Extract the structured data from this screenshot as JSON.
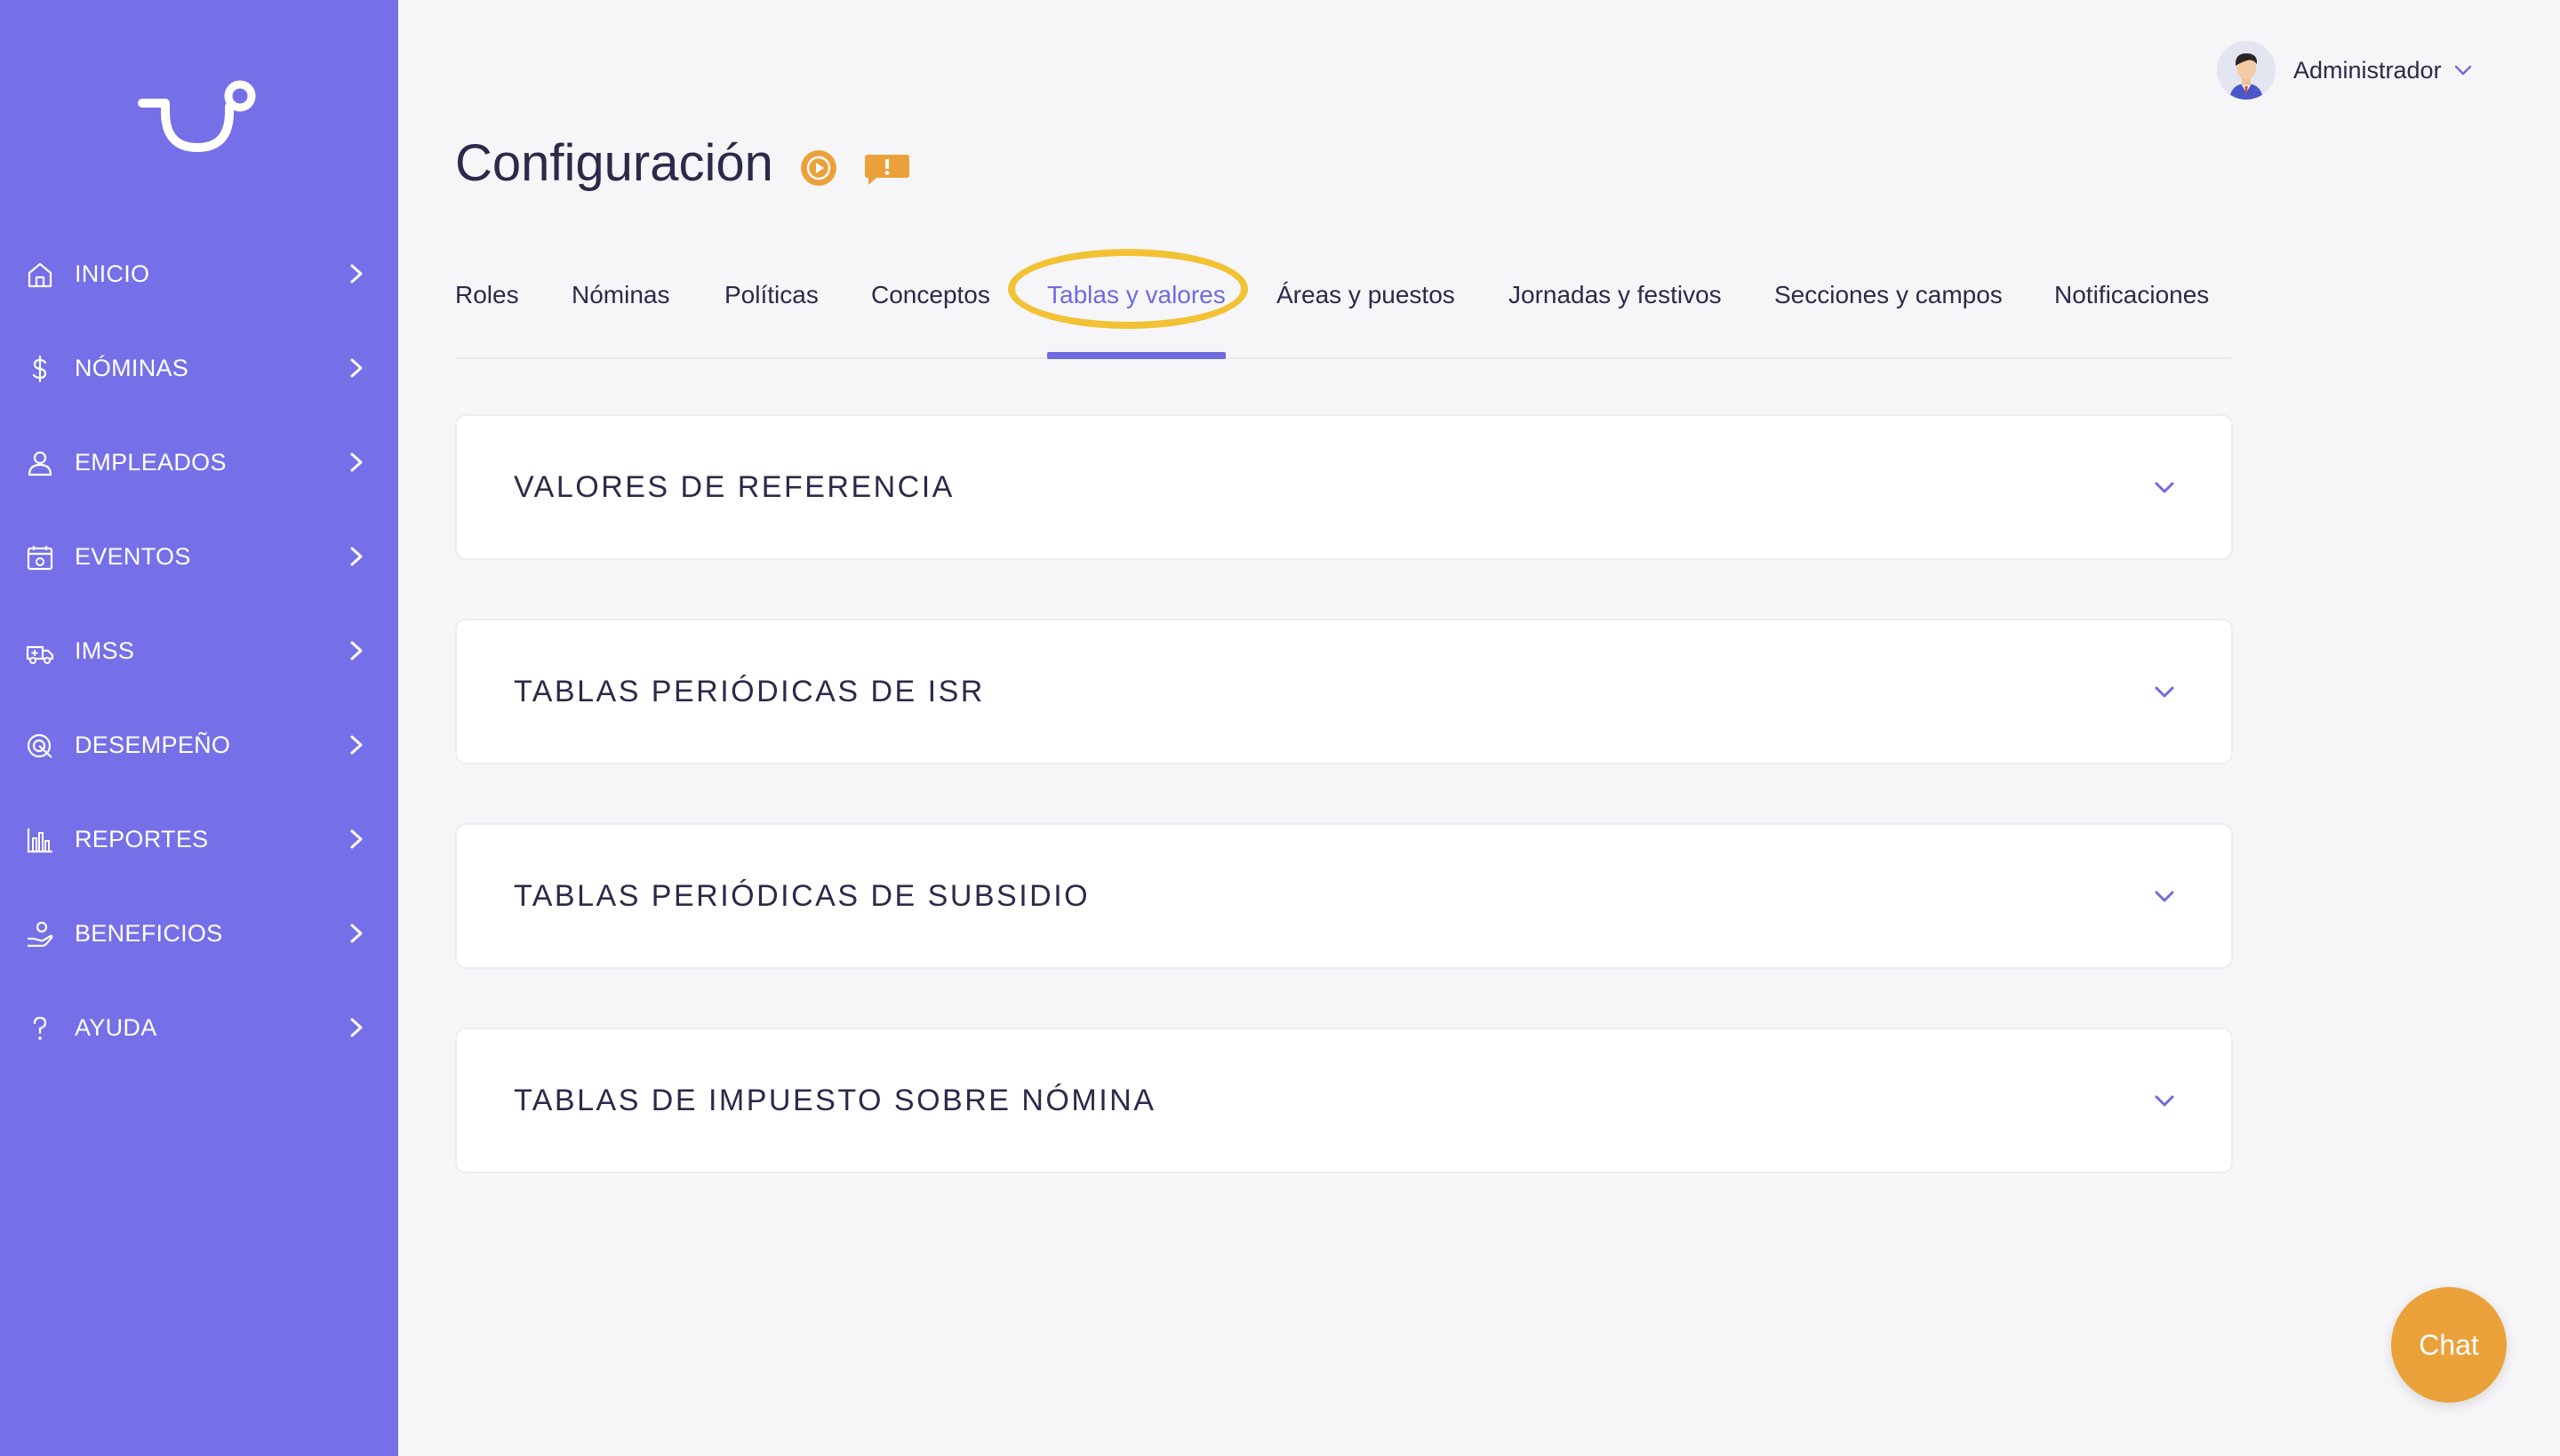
{
  "colors": {
    "sidebar_bg": "#7570e8",
    "accent": "#6e6ae0",
    "highlight": "#f2c234",
    "orange": "#eba13a",
    "text": "#2b2a4a",
    "page_bg": "#f6f6f9"
  },
  "sidebar": {
    "logo": "tu-logo",
    "items": [
      {
        "label": "INICIO",
        "icon": "home-icon"
      },
      {
        "label": "NÓMINAS",
        "icon": "dollar-icon"
      },
      {
        "label": "EMPLEADOS",
        "icon": "user-icon"
      },
      {
        "label": "EVENTOS",
        "icon": "calendar-icon"
      },
      {
        "label": "IMSS",
        "icon": "ambulance-icon"
      },
      {
        "label": "DESEMPEÑO",
        "icon": "target-icon"
      },
      {
        "label": "REPORTES",
        "icon": "bar-chart-icon"
      },
      {
        "label": "BENEFICIOS",
        "icon": "hand-coin-icon"
      },
      {
        "label": "AYUDA",
        "icon": "question-icon"
      }
    ]
  },
  "header": {
    "user_name": "Administrador",
    "title": "Configuración"
  },
  "tabs": [
    {
      "label": "Roles"
    },
    {
      "label": "Nóminas"
    },
    {
      "label": "Políticas"
    },
    {
      "label": "Conceptos"
    },
    {
      "label": "Tablas y valores",
      "active": true
    },
    {
      "label": "Áreas y puestos"
    },
    {
      "label": "Jornadas y festivos"
    },
    {
      "label": "Secciones y campos"
    },
    {
      "label": "Notificaciones"
    }
  ],
  "panels": [
    {
      "title": "VALORES DE REFERENCIA"
    },
    {
      "title": "TABLAS PERIÓDICAS DE ISR"
    },
    {
      "title": "TABLAS PERIÓDICAS DE SUBSIDIO"
    },
    {
      "title": "TABLAS DE IMPUESTO SOBRE NÓMINA"
    }
  ],
  "chat": {
    "label": "Chat"
  }
}
